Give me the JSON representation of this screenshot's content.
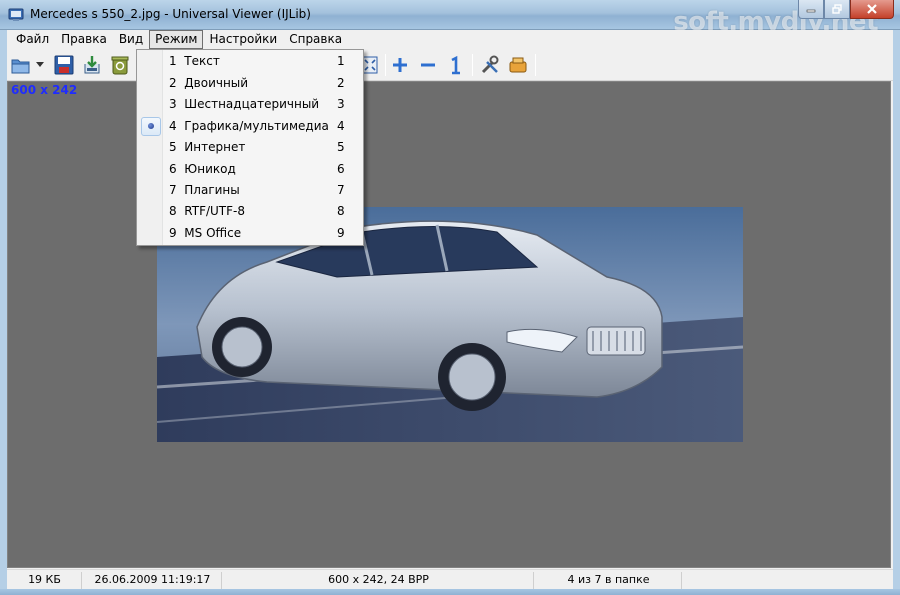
{
  "window": {
    "title": "Mercedes s 550_2.jpg - Universal Viewer (IJLib)",
    "watermark": "soft.mydiv.net",
    "accent": "#8fb1d2"
  },
  "menubar": {
    "items": [
      {
        "label": "Файл",
        "name": "menu-file"
      },
      {
        "label": "Правка",
        "name": "menu-edit"
      },
      {
        "label": "Вид",
        "name": "menu-view"
      },
      {
        "label": "Режим",
        "name": "menu-mode",
        "active": true
      },
      {
        "label": "Настройки",
        "name": "menu-settings"
      },
      {
        "label": "Справка",
        "name": "menu-help"
      }
    ]
  },
  "toolbar": {
    "icons": [
      "open-icon",
      "dropdown-arrow-icon",
      "save-icon",
      "export-icon",
      "recycle-icon",
      "fit-window-icon",
      "zoom-in-icon",
      "zoom-out-icon",
      "actual-size-icon",
      "tools-icon",
      "plugin-icon"
    ]
  },
  "viewer": {
    "dimensions_overlay": "600 x 242",
    "dims_color": "#1f2cff"
  },
  "mode_menu": {
    "items": [
      {
        "number": "1",
        "label": "Текст",
        "key": "1",
        "selected": false
      },
      {
        "number": "2",
        "label": "Двоичный",
        "key": "2",
        "selected": false
      },
      {
        "number": "3",
        "label": "Шестнадцатеричный",
        "key": "3",
        "selected": false
      },
      {
        "number": "4",
        "label": "Графика/мультимедиа",
        "key": "4",
        "selected": true
      },
      {
        "number": "5",
        "label": "Интернет",
        "key": "5",
        "selected": false
      },
      {
        "number": "6",
        "label": "Юникод",
        "key": "6",
        "selected": false
      },
      {
        "number": "7",
        "label": "Плагины",
        "key": "7",
        "selected": false
      },
      {
        "number": "8",
        "label": "RTF/UTF-8",
        "key": "8",
        "selected": false
      },
      {
        "number": "9",
        "label": "MS Office",
        "key": "9",
        "selected": false
      }
    ]
  },
  "statusbar": {
    "size": "19 КБ",
    "date": "26.06.2009 11:19:17",
    "info": "600 x 242, 24 BPP",
    "position": "4 из 7 в папке"
  }
}
